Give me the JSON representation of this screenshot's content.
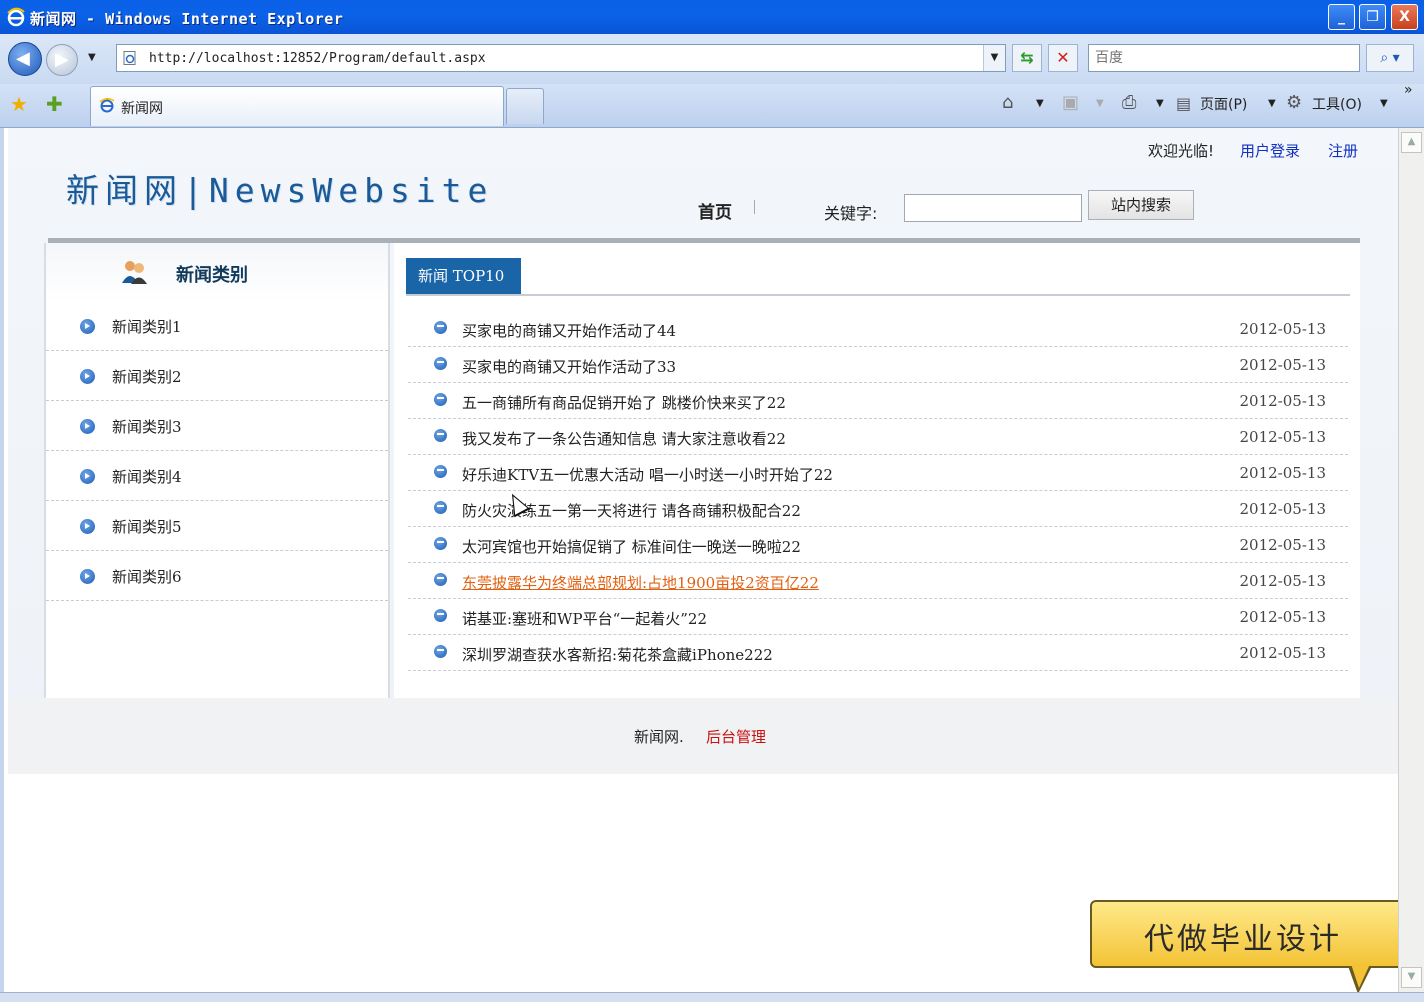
{
  "window": {
    "title": "新闻网 - Windows Internet Explorer",
    "minimize": "_",
    "maximize": "❐",
    "close": "X"
  },
  "nav": {
    "back_icon": "back-arrow-icon",
    "forward_icon": "forward-arrow-icon",
    "url": "http://localhost:12852/Program/default.aspx",
    "search_placeholder": "百度",
    "refresh_glyph": "⇆",
    "stop_glyph": "✕",
    "search_glyph": "⌕ ▾"
  },
  "tabs": {
    "active_label": "新闻网"
  },
  "commands": {
    "page_label": "页面(P)",
    "tools_label": "工具(O)",
    "more": "»"
  },
  "site": {
    "logo": "新闻网|NewsWebsite",
    "welcome": "欢迎光临!",
    "login": "用户登录",
    "register": "注册",
    "nav_home": "首页",
    "keyword_label": "关键字:",
    "search_button": "站内搜索",
    "sidebar_title": "新闻类别",
    "categories": [
      "新闻类别1",
      "新闻类别2",
      "新闻类别3",
      "新闻类别4",
      "新闻类别5",
      "新闻类别6"
    ],
    "top_tab": "新闻 TOP10",
    "news": [
      {
        "title": "买家电的商铺又开始作活动了44",
        "date": "2012-05-13"
      },
      {
        "title": "买家电的商铺又开始作活动了33",
        "date": "2012-05-13"
      },
      {
        "title": "五一商铺所有商品促销开始了 跳楼价快来买了22",
        "date": "2012-05-13"
      },
      {
        "title": "我又发布了一条公告通知信息 请大家注意收看22",
        "date": "2012-05-13"
      },
      {
        "title": "好乐迪KTV五一优惠大活动 唱一小时送一小时开始了22",
        "date": "2012-05-13"
      },
      {
        "title": "防火灾演练五一第一天将进行 请各商铺积极配合22",
        "date": "2012-05-13"
      },
      {
        "title": "太河宾馆也开始搞促销了 标准间住一晚送一晚啦22",
        "date": "2012-05-13"
      },
      {
        "title": "东莞披露华为终端总部规划:占地1900亩投2资百亿22",
        "date": "2012-05-13"
      },
      {
        "title": "诺基亚:塞班和WP平台“一起着火”22",
        "date": "2012-05-13"
      },
      {
        "title": "深圳罗湖查获水客新招:菊花茶盒藏iPhone222",
        "date": "2012-05-13"
      }
    ],
    "footer_name": "新闻网.",
    "footer_admin": "后台管理"
  },
  "overlay": {
    "ad_text": "代做毕业设计"
  },
  "colors": {
    "brand_blue": "#1a64a8",
    "link_blue": "#1030c0",
    "hover_orange": "#e06010",
    "admin_red": "#c81010"
  }
}
